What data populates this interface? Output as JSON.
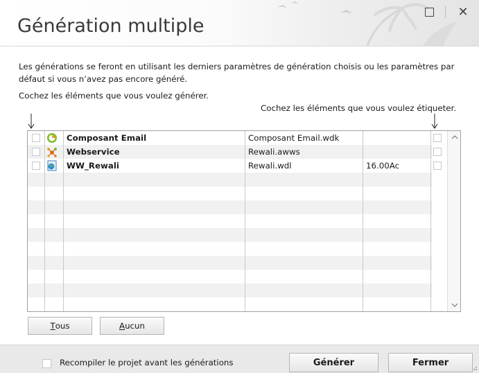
{
  "window": {
    "title": "Génération multiple",
    "maximize_icon": "maximize-icon",
    "close_icon": "close-icon",
    "close_glyph": "✕"
  },
  "description": "Les générations se feront en utilisant les derniers paramètres de génération choisis ou les paramètres par défaut si vous n’avez pas encore généré.",
  "hint_left": "Cochez les éléments que vous voulez générer.",
  "hint_right": "Cochez les éléments que vous voulez étiqueter.",
  "items": [
    {
      "name": "Composant Email",
      "file": "Composant Email.wdk",
      "version": "",
      "icon": "component-icon",
      "generate": false,
      "label": false
    },
    {
      "name": "Webservice",
      "file": "Rewali.awws",
      "version": "",
      "icon": "webservice-icon",
      "generate": false,
      "label": false
    },
    {
      "name": "WW_Rewali",
      "file": "Rewali.wdl",
      "version": "16.00Ac",
      "icon": "webproject-icon",
      "generate": false,
      "label": false
    }
  ],
  "buttons": {
    "all_prefix": "T",
    "all_rest": "ous",
    "none_prefix": "A",
    "none_rest": "ucun",
    "generate": "Générer",
    "close": "Fermer"
  },
  "recompile": {
    "label": "Recompiler le projet avant les générations",
    "checked": false
  },
  "colors": {
    "row_alt": "#f1f1f1",
    "footer": "#e9e9e9",
    "grid_border": "#a0a0a0"
  }
}
